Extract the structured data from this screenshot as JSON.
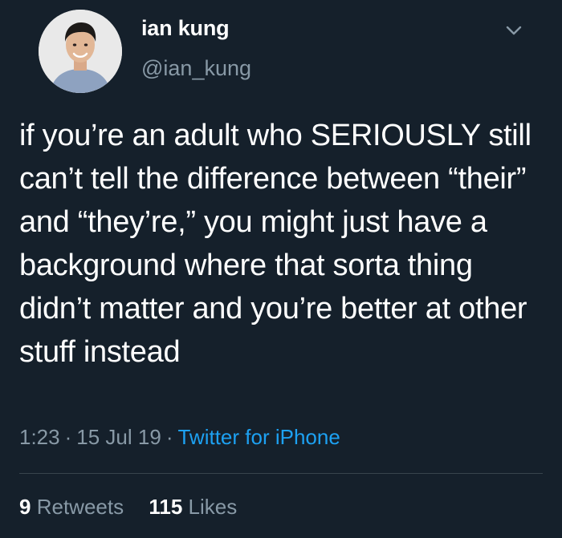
{
  "author": {
    "name": "ian kung",
    "handle": "@ian_kung"
  },
  "tweet": {
    "text": "if you’re an adult who SERIOUSLY still can’t tell the difference between “their” and “they’re,” you might just have a background where that sorta thing didn’t matter and you’re better at other stuff instead",
    "time": "1:23",
    "date": "15 Jul 19",
    "source": "Twitter for iPhone"
  },
  "stats": {
    "retweets_count": "9",
    "retweets_label": "Retweets",
    "likes_count": "115",
    "likes_label": "Likes"
  },
  "icons": {
    "menu": "chevron-down-icon"
  },
  "colors": {
    "background": "#15202b",
    "text_primary": "#ffffff",
    "text_secondary": "#8899a6",
    "link": "#1da1f2",
    "divider": "#38444d"
  }
}
